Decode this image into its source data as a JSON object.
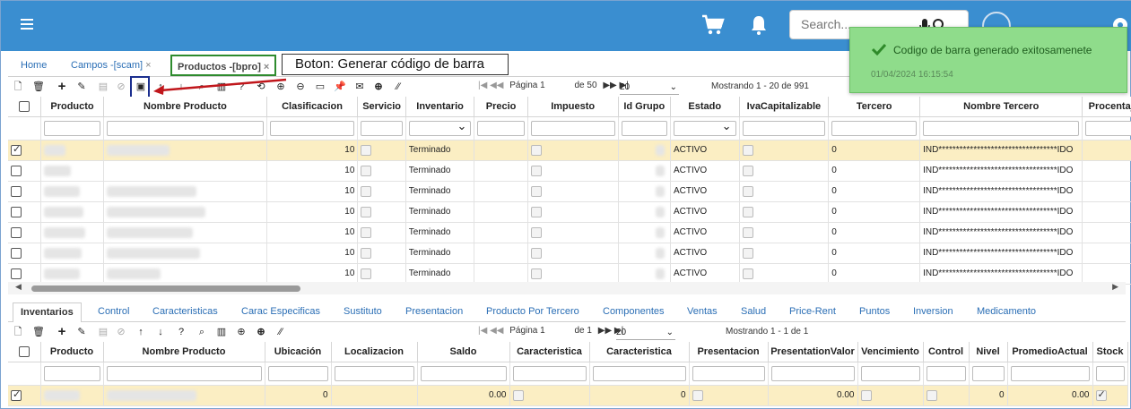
{
  "header": {
    "search_placeholder": "Search...",
    "brand_color": "#3a8ed0"
  },
  "tabs": [
    {
      "label": "Home"
    },
    {
      "label": "Campos -[scam]",
      "close": "×"
    },
    {
      "label": "Productos -[bpro]",
      "close": "×"
    }
  ],
  "callout": "Boton: Generar código de barra",
  "toast": {
    "message": "Codigo de barra generado exitosamenete",
    "time": "01/04/2024 16:15:54"
  },
  "pager": {
    "page_label": "Página 1",
    "of_label": "de 50",
    "page_size": "20",
    "showing": "Mostrando 1 - 20 de 991"
  },
  "grid": {
    "columns": [
      "Producto",
      "Nombre Producto",
      "Clasificacion",
      "Servicio",
      "Inventario",
      "Precio",
      "Impuesto",
      "Id Grupo",
      "Estado",
      "IvaCapitalizable",
      "Tercero",
      "Nombre Tercero",
      "Procentaj"
    ],
    "rows": [
      {
        "clasificacion": "10",
        "inventario": "Terminado",
        "estado": "ACTIVO",
        "tercero": "0",
        "nombre_tercero": "IND**********************************IDO",
        "selected": true
      },
      {
        "clasificacion": "10",
        "inventario": "Terminado",
        "estado": "ACTIVO",
        "tercero": "0",
        "nombre_tercero": "IND**********************************IDO",
        "selected": false
      },
      {
        "clasificacion": "10",
        "inventario": "Terminado",
        "estado": "ACTIVO",
        "tercero": "0",
        "nombre_tercero": "IND**********************************IDO",
        "selected": false
      },
      {
        "clasificacion": "10",
        "inventario": "Terminado",
        "estado": "ACTIVO",
        "tercero": "0",
        "nombre_tercero": "IND**********************************IDO",
        "selected": false
      },
      {
        "clasificacion": "10",
        "inventario": "Terminado",
        "estado": "ACTIVO",
        "tercero": "0",
        "nombre_tercero": "IND**********************************IDO",
        "selected": false
      },
      {
        "clasificacion": "10",
        "inventario": "Terminado",
        "estado": "ACTIVO",
        "tercero": "0",
        "nombre_tercero": "IND**********************************IDO",
        "selected": false
      },
      {
        "clasificacion": "10",
        "inventario": "Terminado",
        "estado": "ACTIVO",
        "tercero": "0",
        "nombre_tercero": "IND**********************************IDO",
        "selected": false
      }
    ]
  },
  "subtabs": [
    "Inventarios",
    "Control",
    "Caracteristicas",
    "Carac Especificas",
    "Sustituto",
    "Presentacion",
    "Producto Por Tercero",
    "Componentes",
    "Ventas",
    "Salud",
    "Price-Rent",
    "Puntos",
    "Inversion",
    "Medicamento"
  ],
  "sub_pager": {
    "page_label": "Página 1",
    "of_label": "de 1",
    "page_size": "20",
    "showing": "Mostrando 1 - 1 de 1"
  },
  "subgrid": {
    "columns": [
      "Producto",
      "Nombre Producto",
      "Ubicación",
      "Localizacion",
      "Saldo",
      "Caracteristica",
      "Caracteristica",
      "Presentacion",
      "PresentationValor",
      "Vencimiento",
      "Control",
      "Nivel",
      "PromedioActual",
      "Stock"
    ],
    "row": {
      "ubicacion": "0",
      "saldo": "0.00",
      "caracteristica2": "0",
      "presentation_valor": "0.00",
      "nivel": "0",
      "promedio": "0.00"
    }
  }
}
